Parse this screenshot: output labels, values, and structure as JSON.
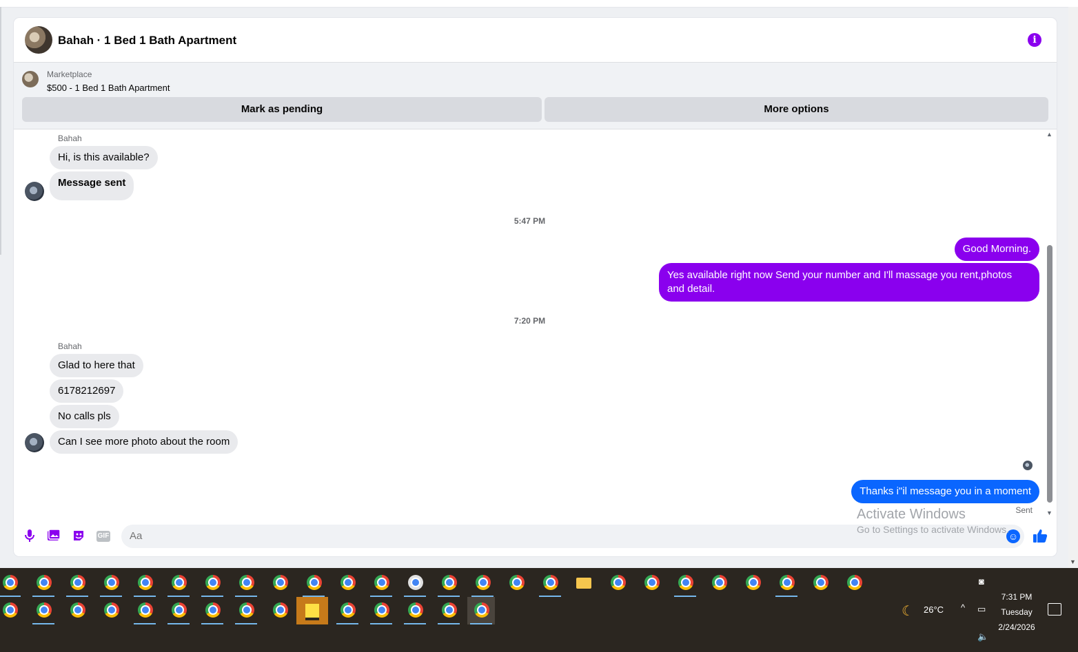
{
  "header": {
    "title": "Bahah · 1 Bed 1 Bath Apartment",
    "info_icon": "info-icon"
  },
  "listing": {
    "category": "Marketplace",
    "price_title": "$500 - 1 Bed 1 Bath Apartment",
    "mark_pending_label": "Mark as pending",
    "more_options_label": "More options"
  },
  "messages": {
    "group1_sender": "Bahah",
    "m1": "Hi, is this available?",
    "m2": "Message sent",
    "ts1": "5:47 PM",
    "out1": "Good Morning.",
    "out2": "Yes available right now Send your number and I'll massage you rent,photos and detail.",
    "ts2": "7:20 PM",
    "group2_sender": "Bahah",
    "m3": "Glad to here that",
    "m4": "6178212697",
    "m5": "No calls pls",
    "m6": "Can I see more photo about the room",
    "out3": "Thanks i\"il message you in a moment",
    "out3_status": "Sent"
  },
  "composer": {
    "placeholder": "Aa",
    "gif_label": "GIF"
  },
  "watermark": {
    "line1": "Activate Windows",
    "line2": "Go to Settings to activate Windows."
  },
  "taskbar": {
    "weather": "26°C",
    "time": "7:31 PM",
    "day": "Tuesday",
    "date": "2/24/2026"
  },
  "colors": {
    "accent_purple": "#8a00ee",
    "accent_blue": "#0a66ff",
    "bubble_incoming": "#e9eaed"
  }
}
